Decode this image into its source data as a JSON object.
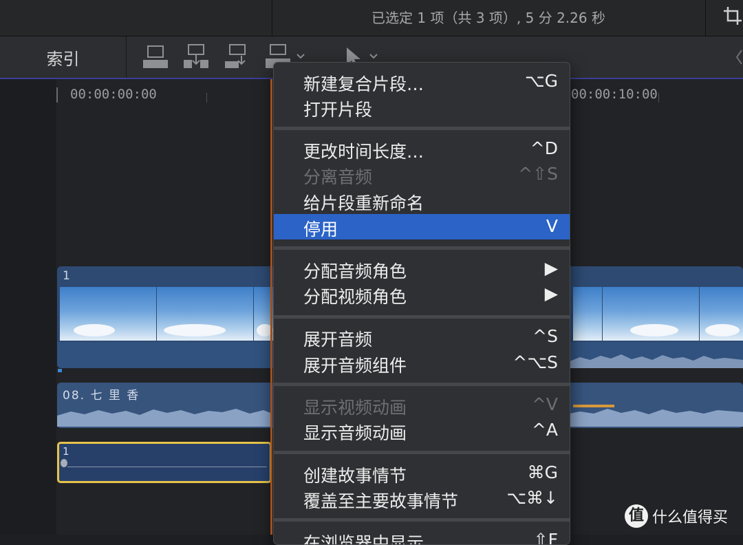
{
  "status": {
    "selection_summary": "已选定 1 项（共 3 项）, 5 分 2.26 秒"
  },
  "toolbar": {
    "index_label": "索引",
    "icons": [
      "append-clip-icon",
      "insert-clip-icon",
      "connect-clip-icon",
      "overwrite-clip-icon",
      "select-tool-icon"
    ]
  },
  "ruler": {
    "start_timecode": "00:00:00:00",
    "end_timecode": "00:00:10:00"
  },
  "timeline": {
    "video_clip_number": "1",
    "music_clip_title": "08. 七 里 香",
    "selected_clip_number": "1"
  },
  "context_menu": {
    "groups": [
      [
        {
          "label": "新建复合片段…",
          "shortcut": "⌥G",
          "enabled": true
        },
        {
          "label": "打开片段",
          "shortcut": "",
          "enabled": true
        }
      ],
      [
        {
          "label": "更改时间长度…",
          "shortcut": "^D",
          "enabled": true
        },
        {
          "label": "分离音频",
          "shortcut": "^⇧S",
          "enabled": false
        },
        {
          "label": "给片段重新命名",
          "shortcut": "",
          "enabled": true
        },
        {
          "label": "停用",
          "shortcut": "V",
          "enabled": true,
          "highlighted": true
        }
      ],
      [
        {
          "label": "分配音频角色",
          "shortcut": "▶",
          "enabled": true
        },
        {
          "label": "分配视频角色",
          "shortcut": "▶",
          "enabled": true
        }
      ],
      [
        {
          "label": "展开音频",
          "shortcut": "^S",
          "enabled": true
        },
        {
          "label": "展开音频组件",
          "shortcut": "^⌥S",
          "enabled": true
        }
      ],
      [
        {
          "label": "显示视频动画",
          "shortcut": "^V",
          "enabled": false
        },
        {
          "label": "显示音频动画",
          "shortcut": "^A",
          "enabled": true
        }
      ],
      [
        {
          "label": "创建故事情节",
          "shortcut": "⌘G",
          "enabled": true
        },
        {
          "label": "覆盖至主要故事情节",
          "shortcut": "⌥⌘↓",
          "enabled": true
        }
      ],
      [
        {
          "label": "在浏览器中显示",
          "shortcut": "⇧F",
          "enabled": true
        }
      ]
    ]
  },
  "watermark": {
    "logo_char": "值",
    "text": "什么值得买"
  },
  "colors": {
    "menu_highlight": "#2b63c7",
    "playhead": "#d06a2e",
    "selected_clip_border": "#e7c44a",
    "video_clip": "#2e4a72",
    "audio_clip": "#37547d"
  }
}
